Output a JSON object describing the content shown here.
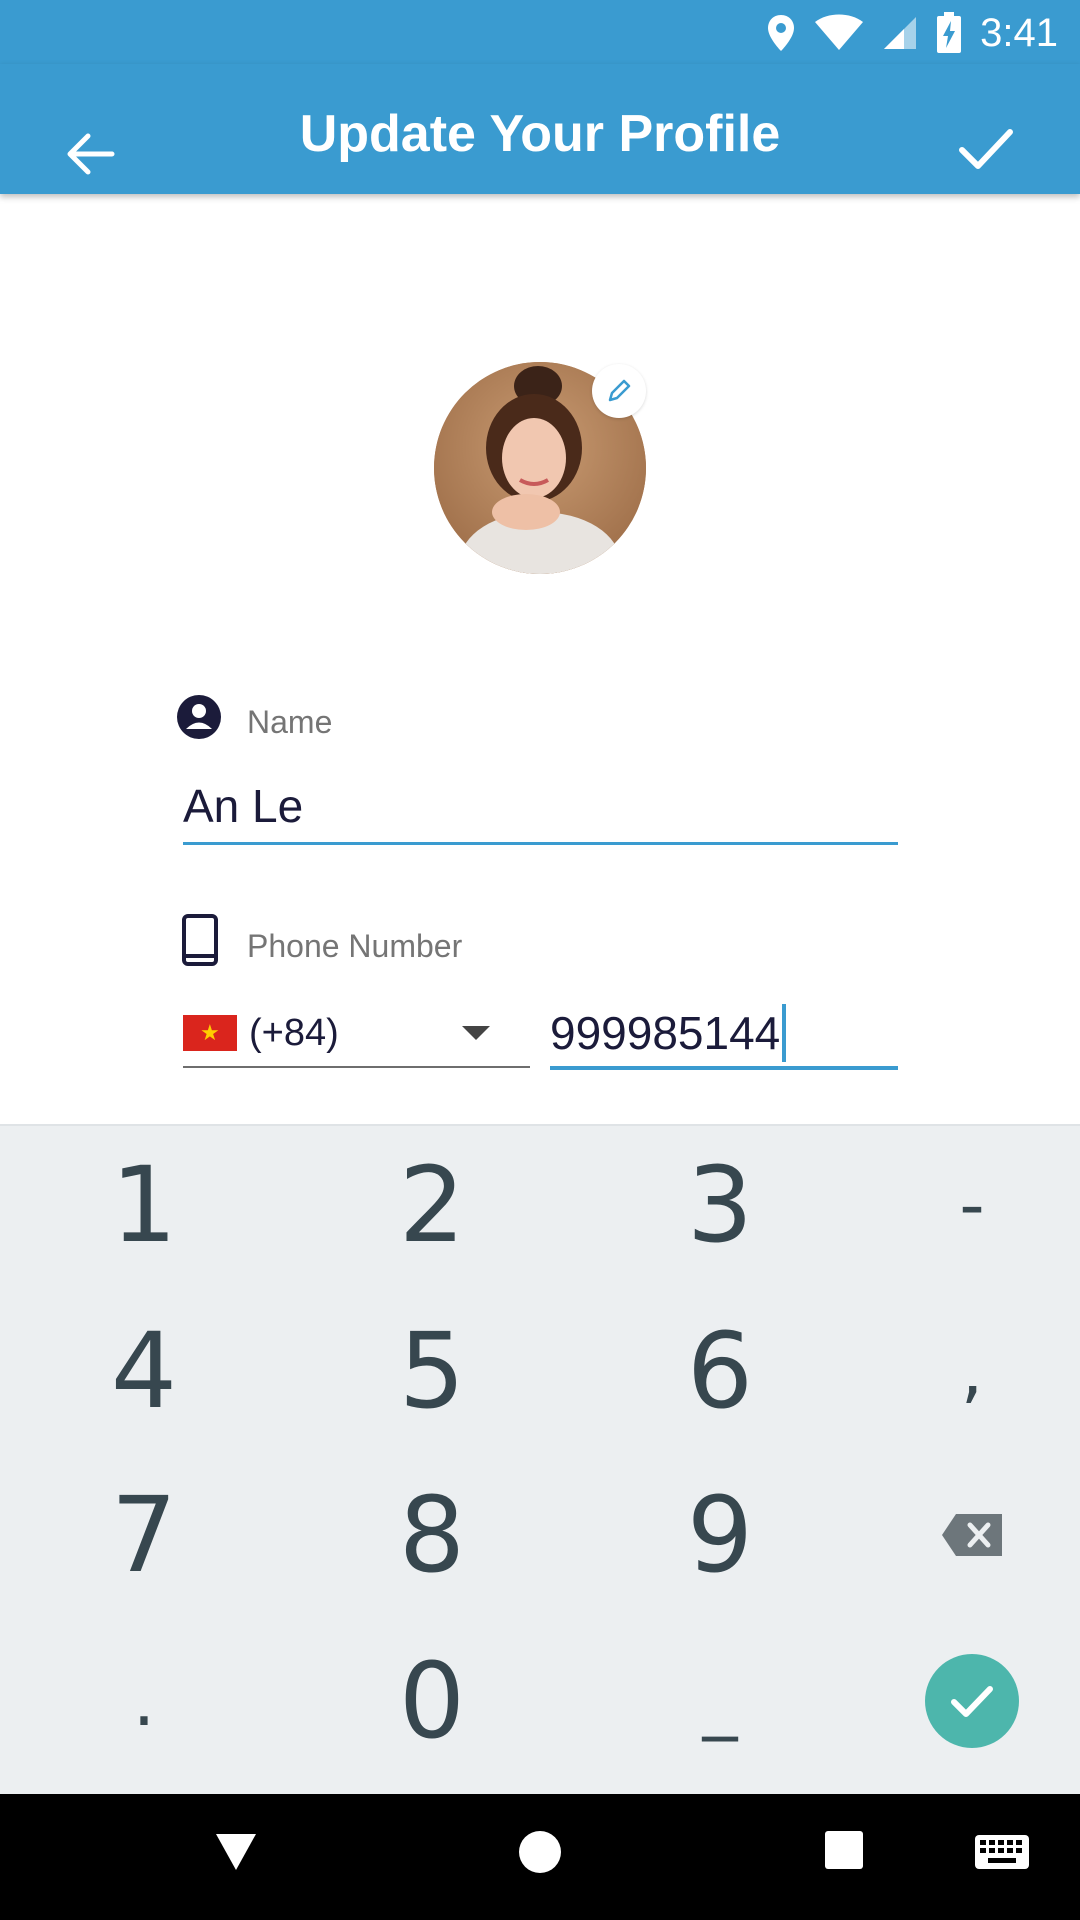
{
  "status_bar": {
    "time": "3:41"
  },
  "app_bar": {
    "title": "Update Your Profile"
  },
  "form": {
    "name_label": "Name",
    "name_value": "An Le",
    "phone_label": "Phone Number",
    "country_code": "(+84)",
    "phone_value": "999985144"
  },
  "keyboard": {
    "row1": [
      "1",
      "2",
      "3",
      "-"
    ],
    "row2": [
      "4",
      "5",
      "6",
      ","
    ],
    "row3": [
      "7",
      "8",
      "9"
    ],
    "row4": [
      ".",
      "0",
      "_"
    ]
  },
  "colors": {
    "primary": "#3a9bd0",
    "keyboard_bg": "#eceff1",
    "key_text": "#37474f",
    "enter": "#4db6ac"
  }
}
